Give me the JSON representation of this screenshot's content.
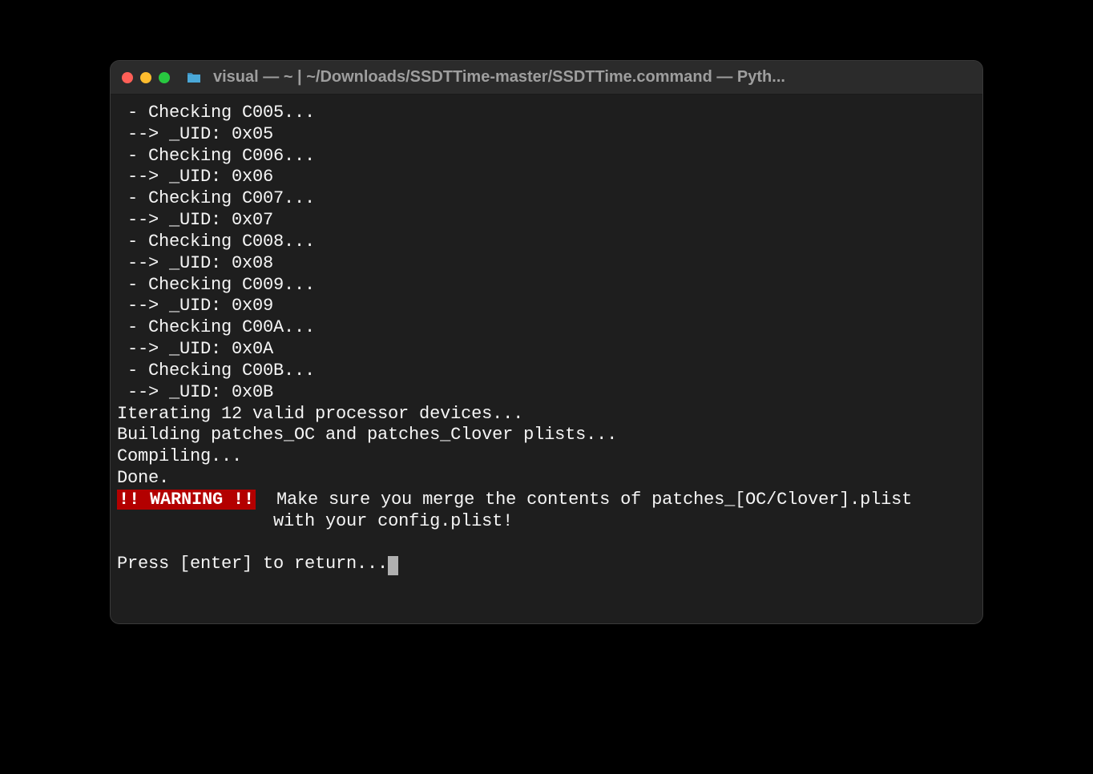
{
  "window": {
    "title": "visual — ~ | ~/Downloads/SSDTTime-master/SSDTTime.command — Pyth..."
  },
  "terminal": {
    "lines": [
      " - Checking C005...",
      " --> _UID: 0x05",
      " - Checking C006...",
      " --> _UID: 0x06",
      " - Checking C007...",
      " --> _UID: 0x07",
      " - Checking C008...",
      " --> _UID: 0x08",
      " - Checking C009...",
      " --> _UID: 0x09",
      " - Checking C00A...",
      " --> _UID: 0x0A",
      " - Checking C00B...",
      " --> _UID: 0x0B",
      "Iterating 12 valid processor devices...",
      "Building patches_OC and patches_Clover plists...",
      "Compiling...",
      "",
      "Done.",
      ""
    ],
    "warning_badge": "!! WARNING !!",
    "warning_line1": "  Make sure you merge the contents of patches_[OC/Clover].plist",
    "warning_line2": "               with your config.plist!",
    "blank_after_warning": "",
    "prompt": "Press [enter] to return..."
  }
}
